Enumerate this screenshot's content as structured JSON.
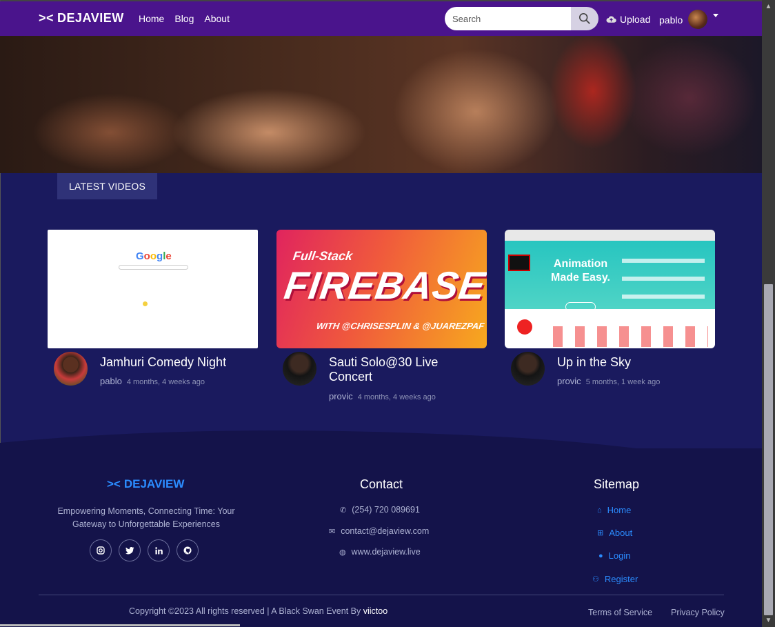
{
  "navbar": {
    "brand_mark": "><",
    "brand": "DEJAVIEW",
    "links": [
      "Home",
      "Blog",
      "About"
    ],
    "search_placeholder": "Search",
    "upload_label": "Upload",
    "username": "pablo"
  },
  "section": {
    "latest_label": "LATEST VIDEOS"
  },
  "videos": [
    {
      "title": "Jamhuri Comedy Night",
      "author": "pablo",
      "ago": "4 months, 4 weeks ago",
      "thumb_text": "Google"
    },
    {
      "title": "Sauti Solo@30 Live Concert",
      "author": "provic",
      "ago": "4 months, 4 weeks ago",
      "thumb_top": "Full-Stack",
      "thumb_main": "FIREBASE",
      "thumb_sub": "WITH @CHRISESPLIN & @JUAREZPAF"
    },
    {
      "title": "Up in the Sky",
      "author": "provic",
      "ago": "5 months, 1 week ago",
      "thumb_text": "Animation Made Easy."
    }
  ],
  "footer": {
    "brand_mark": "><",
    "brand": "DEJAVIEW",
    "tagline": "Empowering Moments, Connecting Time: Your Gateway to Unforgettable Experiences",
    "socials": [
      "instagram",
      "twitter",
      "linkedin",
      "github"
    ],
    "contact_title": "Contact",
    "phone": "(254) 720 089691",
    "email": "contact@dejaview.com",
    "website": "www.dejaview.live",
    "sitemap_title": "Sitemap",
    "sitemap": [
      "Home",
      "About",
      "Login",
      "Register"
    ],
    "copyright": "Copyright ©2023 All rights reserved | A Black Swan Event By",
    "copyright_by": "viictoo",
    "terms": "Terms of Service",
    "privacy": "Privacy Policy"
  },
  "colors": {
    "nav": "#4a148c",
    "page": "#1a1a5e",
    "footer": "#14134a",
    "accent": "#2b8cff"
  }
}
